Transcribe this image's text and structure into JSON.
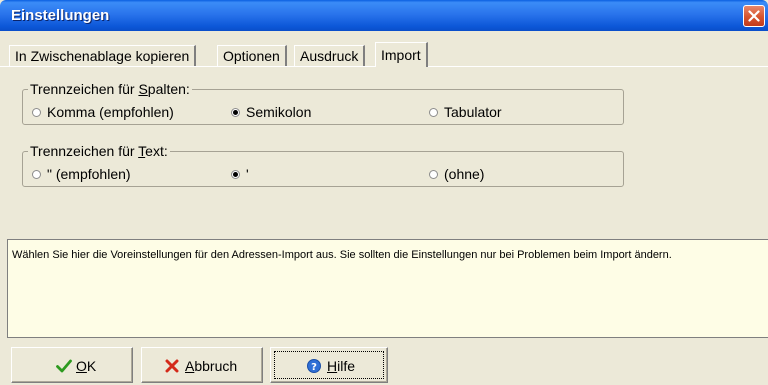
{
  "window": {
    "title": "Einstellungen",
    "icons": {
      "close": "close-icon"
    }
  },
  "tabs": [
    {
      "label": "In Zwischenablage kopieren",
      "active": false
    },
    {
      "label": "Optionen",
      "active": false
    },
    {
      "label": "Ausdruck",
      "active": false
    },
    {
      "label": "Import",
      "active": true
    }
  ],
  "column_separator": {
    "legend_prefix": "Trennzeichen für ",
    "legend_hotkey": "S",
    "legend_suffix": "palten:",
    "options": [
      {
        "label": "Komma (empfohlen)",
        "checked": false
      },
      {
        "label": "Semikolon",
        "checked": true
      },
      {
        "label": "Tabulator",
        "checked": false
      }
    ]
  },
  "text_separator": {
    "legend_prefix": "Trennzeichen für ",
    "legend_hotkey": "T",
    "legend_suffix": "ext:",
    "options": [
      {
        "label": "\" (empfohlen)",
        "checked": false
      },
      {
        "label": "'",
        "checked": true
      },
      {
        "label": "(ohne)",
        "checked": false
      }
    ]
  },
  "info_text": "Wählen Sie hier die Voreinstellungen für den Adressen-Import aus. Sie sollten die Einstellungen nur bei Problemen beim Import ändern.",
  "buttons": {
    "ok": {
      "hotkey": "O",
      "rest": "K",
      "icon": "checkmark-icon"
    },
    "cancel": {
      "hotkey": "A",
      "rest": "bbruch",
      "icon": "red-x-icon"
    },
    "help": {
      "hotkey": "H",
      "rest": "ilfe",
      "icon": "help-icon"
    }
  },
  "colors": {
    "titlebar": "#0a5fe0",
    "dialog_bg": "#ece9d8",
    "info_bg": "#fefde6",
    "ok_check": "#2d9a1f",
    "cancel_x": "#d42a1a",
    "help_icon": "#2f6fd6"
  }
}
